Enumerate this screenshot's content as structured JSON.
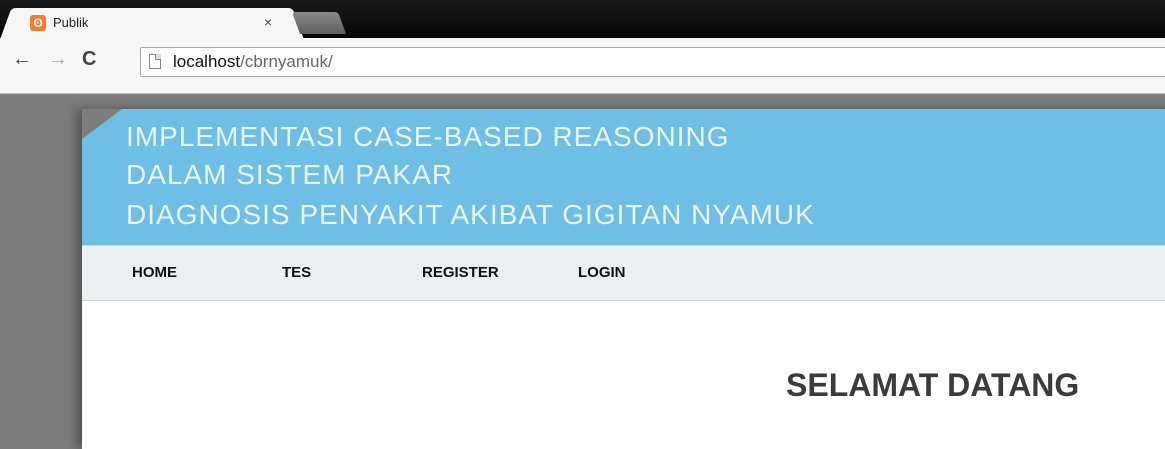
{
  "browser": {
    "tab_title": "Publik",
    "tab_close": "×",
    "favicon_glyph": "ʘ",
    "url_host": "localhost",
    "url_path": "/cbrnyamuk/",
    "back": "←",
    "forward": "→",
    "reload": "C"
  },
  "header": {
    "line1": "IMPLEMENTASI CASE-BASED REASONING",
    "line2": "DALAM SISTEM PAKAR",
    "line3": "DIAGNOSIS PENYAKIT AKIBAT GIGITAN NYAMUK",
    "color": "#6fbee6"
  },
  "menu": {
    "home": "HOME",
    "tes": "TES",
    "register": "REGISTER",
    "login": "LOGIN"
  },
  "main": {
    "welcome": "SELAMAT DATANG"
  }
}
